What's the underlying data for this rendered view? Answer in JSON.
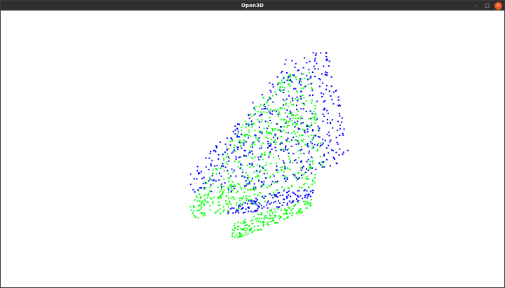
{
  "window": {
    "title": "Open3D",
    "controls": {
      "minimize_symbol": "–",
      "maximize_symbol": "□",
      "close_symbol": "×"
    }
  },
  "viewport": {
    "background": "#ffffff",
    "point_colors": {
      "source": "#0000ff",
      "target": "#00ff00"
    }
  }
}
